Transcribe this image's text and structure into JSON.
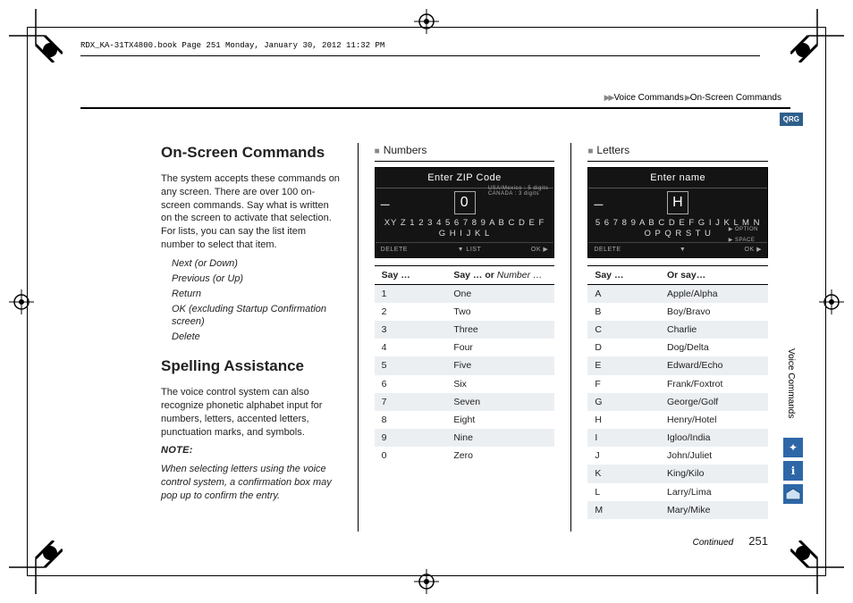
{
  "jobline": "RDX_KA-31TX4800.book  Page 251  Monday, January 30, 2012  11:32 PM",
  "breadcrumb": {
    "a": "Voice Commands",
    "b": "On-Screen Commands"
  },
  "qrg": "QRG",
  "side_label": "Voice Commands",
  "page_continued": "Continued",
  "page_number": "251",
  "col1": {
    "h_onscreen": "On-Screen Commands",
    "p1": "The system accepts these commands on any screen. There are over 100 on-screen commands. Say what is written on the screen to activate that selection. For lists, you can say the list item number to select that item.",
    "cmds": [
      "Next (or Down)",
      "Previous (or Up)",
      "Return",
      "OK (excluding Startup Confirmation screen)",
      "Delete"
    ],
    "h_spell": "Spelling Assistance",
    "p2": "The voice control system can also recognize phonetic alphabet input for numbers, letters, accented letters, punctuation marks, and symbols.",
    "note_hd": "NOTE:",
    "note": "When selecting letters using the voice control system, a confirmation box may pop up to confirm the entry."
  },
  "col2": {
    "h": "Numbers",
    "screen": {
      "title": "Enter ZIP Code",
      "big": "0",
      "row": "XY Z 1 2 3 4 5 6 7 8 9    A B C D E F G H I J K L",
      "hint1": "USA/Mexico : 5 digits",
      "hint2": "CANADA : 3 digits",
      "foot_l": "DELETE",
      "foot_c": "▼ LIST",
      "foot_r": "OK ▶"
    },
    "th1": "Say …",
    "th2_a": "Say … or ",
    "th2_b": "Number …",
    "rows": [
      [
        "1",
        "One"
      ],
      [
        "2",
        "Two"
      ],
      [
        "3",
        "Three"
      ],
      [
        "4",
        "Four"
      ],
      [
        "5",
        "Five"
      ],
      [
        "6",
        "Six"
      ],
      [
        "7",
        "Seven"
      ],
      [
        "8",
        "Eight"
      ],
      [
        "9",
        "Nine"
      ],
      [
        "0",
        "Zero"
      ]
    ]
  },
  "col3": {
    "h": "Letters",
    "screen": {
      "title": "Enter name",
      "big": "H",
      "row": "5 6 7 8 9  A B C D E F G   I J K L M N O P Q R S T U",
      "opt": "▶ OPTION",
      "space": "▶ SPACE",
      "foot_l": "DELETE",
      "foot_c": "▼",
      "foot_r": "OK ▶"
    },
    "th1": "Say …",
    "th2": "Or say…",
    "rows": [
      [
        "A",
        "Apple/Alpha"
      ],
      [
        "B",
        "Boy/Bravo"
      ],
      [
        "C",
        "Charlie"
      ],
      [
        "D",
        "Dog/Delta"
      ],
      [
        "E",
        "Edward/Echo"
      ],
      [
        "F",
        "Frank/Foxtrot"
      ],
      [
        "G",
        "George/Golf"
      ],
      [
        "H",
        "Henry/Hotel"
      ],
      [
        "I",
        "Igloo/India"
      ],
      [
        "J",
        "John/Juliet"
      ],
      [
        "K",
        "King/Kilo"
      ],
      [
        "L",
        "Larry/Lima"
      ],
      [
        "M",
        "Mary/Mike"
      ]
    ]
  }
}
